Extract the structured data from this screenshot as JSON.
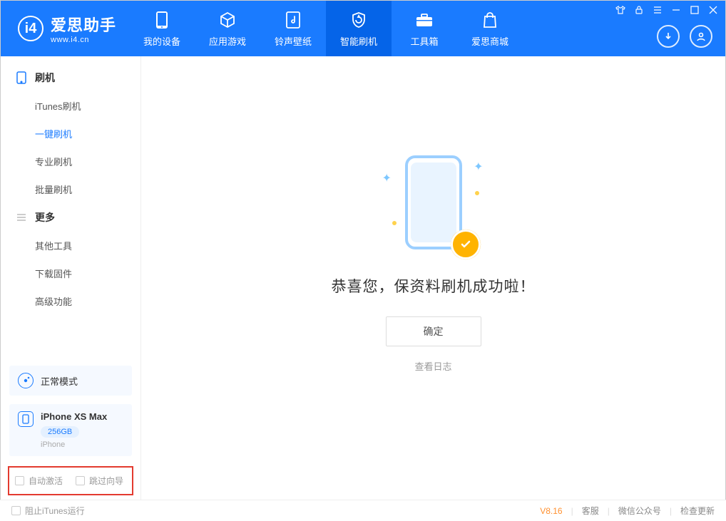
{
  "app": {
    "title": "爱思助手",
    "url": "www.i4.cn"
  },
  "nav": {
    "tabs": [
      {
        "label": "我的设备"
      },
      {
        "label": "应用游戏"
      },
      {
        "label": "铃声壁纸"
      },
      {
        "label": "智能刷机"
      },
      {
        "label": "工具箱"
      },
      {
        "label": "爱思商城"
      }
    ]
  },
  "sidebar": {
    "group1_label": "刷机",
    "group1_items": [
      {
        "label": "iTunes刷机"
      },
      {
        "label": "一键刷机"
      },
      {
        "label": "专业刷机"
      },
      {
        "label": "批量刷机"
      }
    ],
    "group2_label": "更多",
    "group2_items": [
      {
        "label": "其他工具"
      },
      {
        "label": "下载固件"
      },
      {
        "label": "高级功能"
      }
    ],
    "mode_label": "正常模式",
    "device": {
      "name": "iPhone XS Max",
      "capacity": "256GB",
      "type": "iPhone"
    },
    "options": {
      "auto_activate": "自动激活",
      "skip_wizard": "跳过向导"
    }
  },
  "main": {
    "success_message": "恭喜您，保资料刷机成功啦！",
    "confirm_label": "确定",
    "log_link": "查看日志"
  },
  "statusbar": {
    "block_itunes": "阻止iTunes运行",
    "version": "V8.16",
    "support": "客服",
    "wechat": "微信公众号",
    "check_update": "检查更新"
  }
}
